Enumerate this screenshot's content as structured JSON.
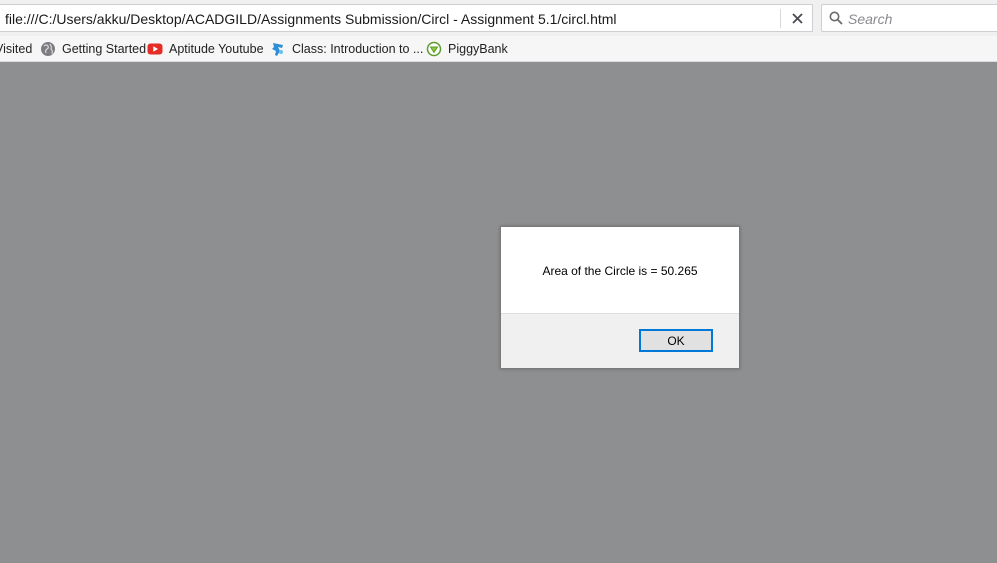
{
  "browser": {
    "url": "file:///C:/Users/akku/Desktop/ACADGILD/Assignments Submission/Circl - Assignment 5.1/circl.html",
    "clear_label": "×",
    "search_placeholder": "Search"
  },
  "bookmarks": [
    {
      "label": "Visited",
      "icon": "none"
    },
    {
      "label": "Getting Started",
      "icon": "globe-icon"
    },
    {
      "label": "Aptitude Youtube",
      "icon": "youtube-icon"
    },
    {
      "label": "Class: Introduction to ...",
      "icon": "class-icon"
    },
    {
      "label": "PiggyBank",
      "icon": "piggybank-icon"
    }
  ],
  "dialog": {
    "message": "Area of the Circle is = 50.265",
    "ok_label": "OK"
  },
  "colors": {
    "page_overlay": "#8e8f91",
    "youtube_red": "#e52d27",
    "focus_blue": "#0078d7"
  }
}
